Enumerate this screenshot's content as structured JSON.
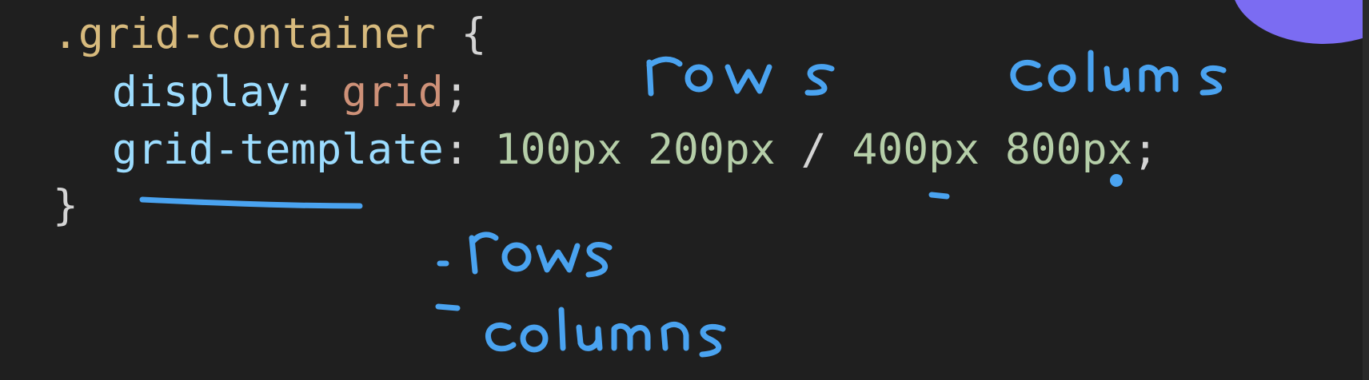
{
  "code": {
    "line1": {
      "selector": ".grid-container",
      "open_brace": " {"
    },
    "line2": {
      "property": "display",
      "colon": ": ",
      "value": "grid",
      "semicolon": ";"
    },
    "line3": {
      "property": "grid-template",
      "colon": ": ",
      "rows_value": "100px 200px",
      "slash": " / ",
      "columns_value": "400px 800px",
      "semicolon": ";"
    },
    "line4": {
      "close_brace": "}"
    }
  },
  "annotations": {
    "rows_label": "rows",
    "columns_label": "colums",
    "list_item_rows": "rows",
    "list_item_columns": "columns",
    "ink_color": "#4aa3f0"
  },
  "theme": {
    "background": "#1f1f1f",
    "accent": "#7b6cf2"
  }
}
